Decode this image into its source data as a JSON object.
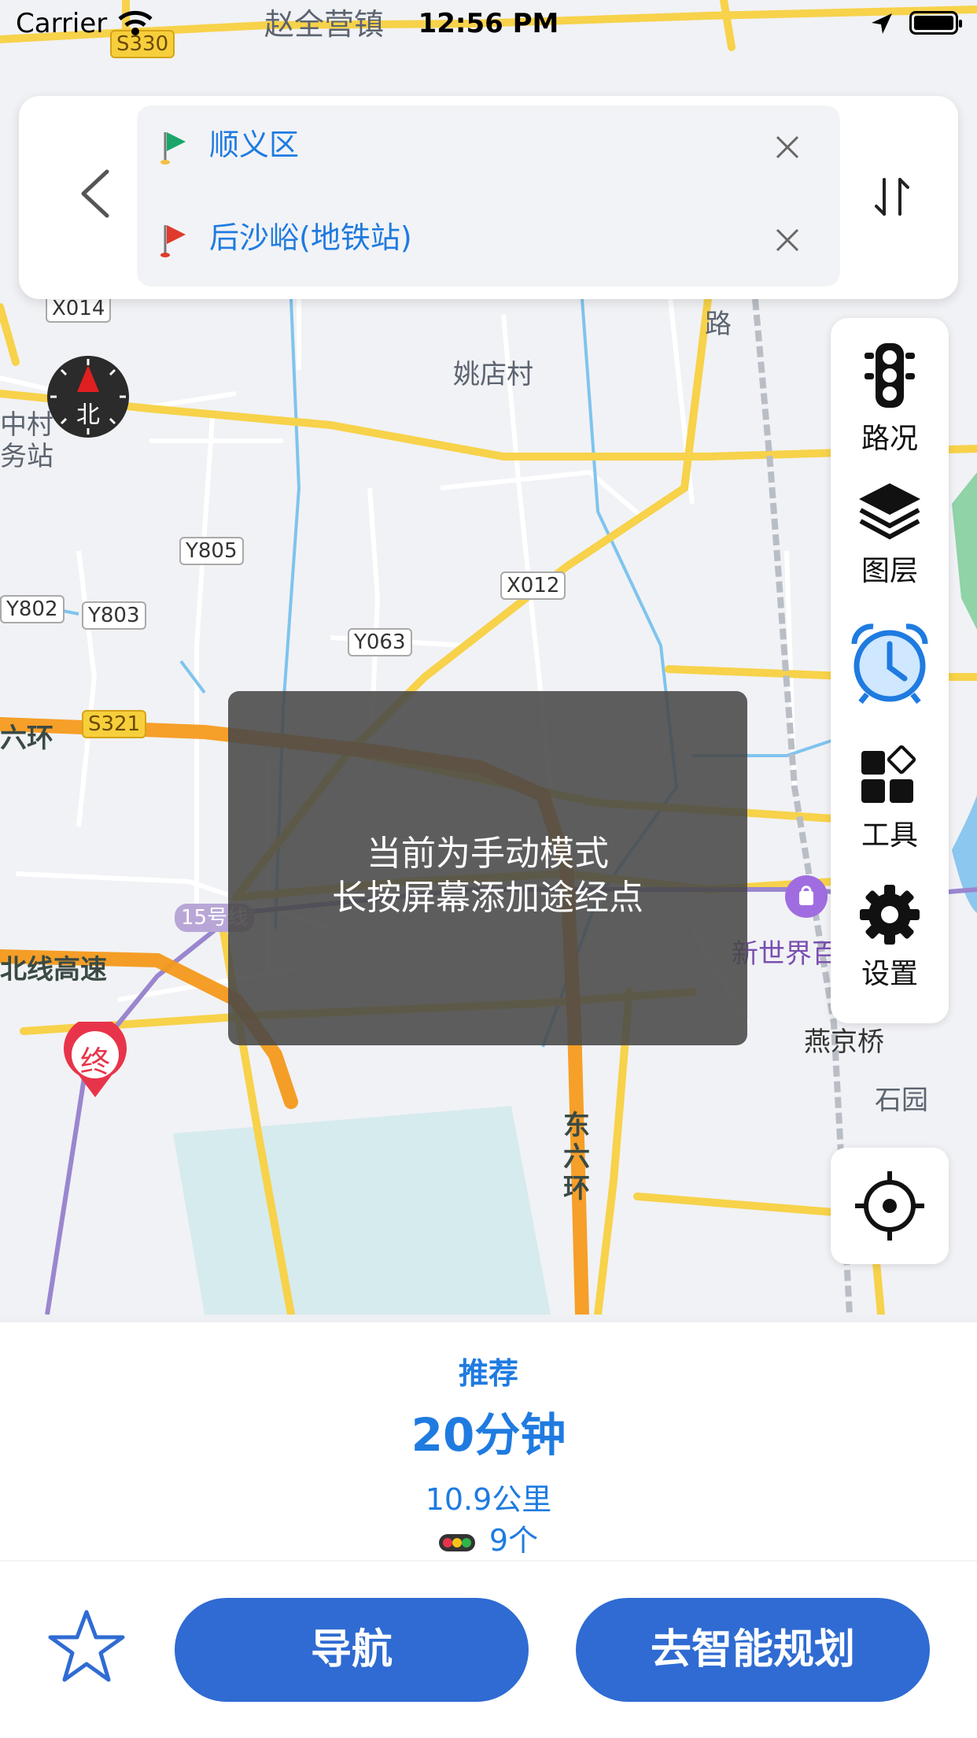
{
  "status_bar": {
    "carrier": "Carrier",
    "time": "12:56 PM"
  },
  "route": {
    "start": "顺义区",
    "end": "后沙峪(地铁站)"
  },
  "map": {
    "compass_label": "北",
    "destination_marker": "终",
    "labels": {
      "zhaoquanying": "赵全营镇",
      "yaodiancun": "姚店村",
      "liuhuan": "六环",
      "beixian": "北线高速",
      "dongliuhuan": "东六环",
      "xinshijie": "新世界百",
      "yanjingqiao": "燕京桥",
      "shiyuan": "石园",
      "lu": "路",
      "zhongcun": "中村",
      "wuzhan": "务站"
    },
    "road_tags": {
      "s330": "S330",
      "x014": "X014",
      "y805": "Y805",
      "x012": "X012",
      "y802": "Y802",
      "y803": "Y803",
      "y063": "Y063",
      "s321": "S321",
      "line15": "15号线"
    }
  },
  "toolbar": {
    "traffic": "路况",
    "layers": "图层",
    "tools": "工具",
    "settings": "设置"
  },
  "toast": {
    "line1": "当前为手动模式",
    "line2": "长按屏幕添加途经点"
  },
  "plan": {
    "tag": "推荐",
    "duration": "20分钟",
    "distance": "10.9公里",
    "traffic_lights": "9个"
  },
  "actions": {
    "navigate": "导航",
    "smart_plan": "去智能规划"
  },
  "colors": {
    "accent": "#1f7be0",
    "button": "#2f6bd2",
    "route_orange": "#f59a1d",
    "road_yellow": "#f7d24a"
  }
}
